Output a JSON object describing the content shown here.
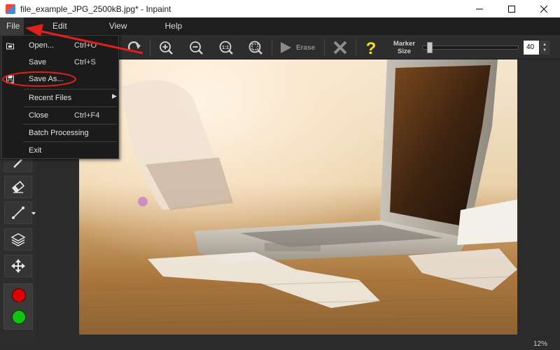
{
  "window": {
    "title": "file_example_JPG_2500kB.jpg* - Inpaint",
    "controls": [
      "minimize",
      "maximize",
      "close"
    ]
  },
  "menu": {
    "items": [
      "File",
      "Edit",
      "View",
      "Help"
    ],
    "active": "File"
  },
  "file_menu": {
    "items": [
      {
        "label": "Open...",
        "shortcut": "Ctrl+O",
        "icon": "open-folder-icon"
      },
      {
        "label": "Save",
        "shortcut": "Ctrl+S",
        "icon": ""
      },
      {
        "label": "Save As...",
        "shortcut": "",
        "icon": "floppy-disk-icon",
        "highlighted": true
      },
      {
        "label": "Recent Files",
        "shortcut": "",
        "submenu": true
      },
      {
        "label": "Close",
        "shortcut": "Ctrl+F4"
      },
      {
        "label": "Batch Processing",
        "shortcut": ""
      },
      {
        "label": "Exit",
        "shortcut": ""
      }
    ],
    "submenu_arrow": "▶"
  },
  "toolbar": {
    "buttons": [
      "redo-icon",
      "zoom-in-icon",
      "zoom-out-icon",
      "zoom-actual-icon",
      "zoom-fit-icon",
      "erase-play-icon",
      "cancel-icon",
      "help-icon"
    ],
    "erase_label": "Erase",
    "marker_size_label": "Marker Size",
    "marker_size_value": "40",
    "marker_size_fraction": 0.05
  },
  "tools": [
    "magic-wand-icon",
    "eraser-icon",
    "line-icon",
    "layers-icon",
    "move-icon"
  ],
  "colors": {
    "primary": "#e00000",
    "secondary": "#12c412",
    "accent_red": "#e0201a",
    "help_yellow": "#f4e21c"
  },
  "status": {
    "zoom": "12%"
  }
}
